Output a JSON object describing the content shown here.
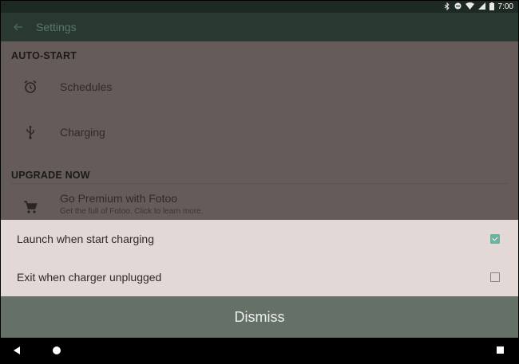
{
  "status_bar": {
    "icons": [
      "bluetooth-icon",
      "do-not-disturb-icon",
      "wifi-icon",
      "signal-icon",
      "battery-icon"
    ],
    "time": "7:00"
  },
  "app_bar": {
    "title": "Settings"
  },
  "sections": [
    {
      "header": "AUTO-START",
      "items": [
        {
          "label": "Schedules",
          "icon": "alarm-clock-icon"
        },
        {
          "label": "Charging",
          "icon": "usb-icon"
        }
      ]
    },
    {
      "header": "UPGRADE NOW",
      "items": [
        {
          "label": "Go Premium with Fotoo",
          "sublabel": "Get the full of Fotoo. Click to learn more.",
          "icon": "cart-icon"
        }
      ]
    }
  ],
  "sheet": {
    "options": [
      {
        "label": "Launch when start charging",
        "checked": true
      },
      {
        "label": "Exit when charger unplugged",
        "checked": false
      }
    ],
    "dismiss_label": "Dismiss"
  },
  "colors": {
    "accent": "#69b3a0",
    "scrim": "#655c59",
    "sheet": "#e2d9d6",
    "dismiss_bar": "#657067"
  }
}
